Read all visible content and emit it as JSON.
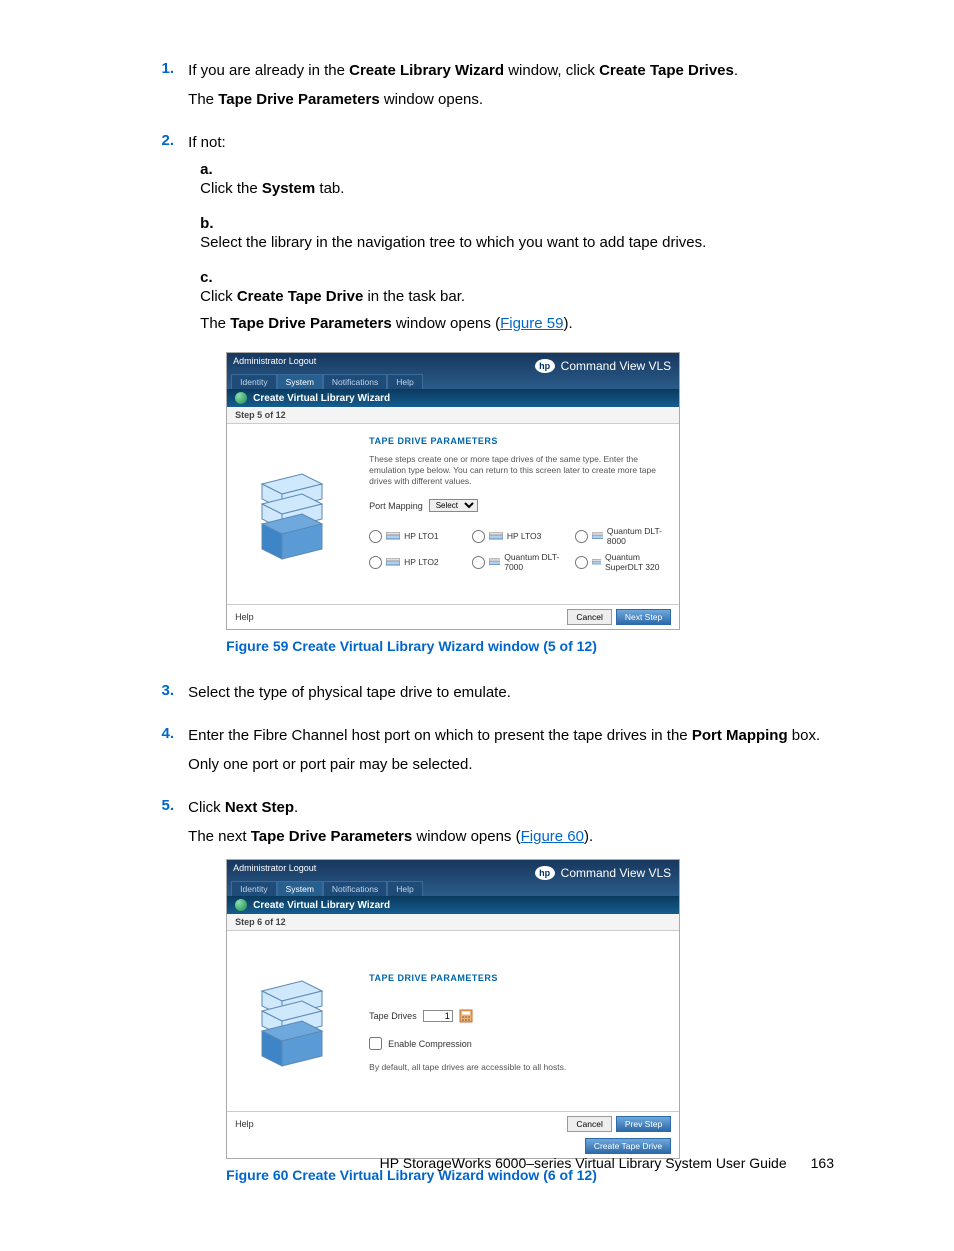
{
  "steps": {
    "s1_a": "If you are already in the ",
    "s1_b": "Create Library Wizard",
    "s1_c": " window, click ",
    "s1_d": "Create Tape Drives",
    "s1_e": ".",
    "s1_f": "The ",
    "s1_g": "Tape Drive Parameters",
    "s1_h": " window opens.",
    "s2": "If not:",
    "s2a_a": "Click the ",
    "s2a_b": "System",
    "s2a_c": " tab.",
    "s2b": "Select the library in the navigation tree to which you want to add tape drives.",
    "s2c_a": "Click ",
    "s2c_b": "Create Tape Drive",
    "s2c_c": " in the task bar.",
    "s2c_d": "The ",
    "s2c_e": "Tape Drive Parameters",
    "s2c_f": " window opens (",
    "s2c_g": "Figure 59",
    "s2c_h": ").",
    "s3": "Select the type of physical tape drive to emulate.",
    "s4_a": "Enter the Fibre Channel host port on which to present the tape drives in the ",
    "s4_b": "Port Mapping",
    "s4_c": " box.",
    "s4_d": "Only one port or port pair may be selected.",
    "s5_a": "Click ",
    "s5_b": "Next Step",
    "s5_c": ".",
    "s5_d": "The next ",
    "s5_e": "Tape Drive Parameters",
    "s5_f": " window opens (",
    "s5_g": "Figure 60",
    "s5_h": ")."
  },
  "markers": {
    "n1": "1.",
    "n2": "2.",
    "n3": "3.",
    "n4": "4.",
    "n5": "5.",
    "la": "a.",
    "lb": "b.",
    "lc": "c."
  },
  "fig59": {
    "caption": "Figure 59 Create Virtual Library Wizard window (5 of 12)",
    "top_left": "Administrator Logout",
    "brand": "Command View VLS",
    "hp": "hp",
    "tabs": {
      "identity": "Identity",
      "system": "System",
      "notifications": "Notifications",
      "help": "Help"
    },
    "bar": "Create Virtual Library Wizard",
    "step": "Step 5 of 12",
    "title": "TAPE DRIVE PARAMETERS",
    "desc": "These steps create one or more tape drives of the same type. Enter the emulation type below. You can return to this screen later to create more tape drives with different values.",
    "portmap": "Port Mapping",
    "select": "Select",
    "radios": {
      "r1": "HP LTO1",
      "r2": "HP LTO3",
      "r3": "Quantum DLT-8000",
      "r4": "HP LTO2",
      "r5": "Quantum DLT-7000",
      "r6": "Quantum SuperDLT 320"
    },
    "foot_help": "Help",
    "btn_cancel": "Cancel",
    "btn_next": "Next Step"
  },
  "fig60": {
    "caption": "Figure 60 Create Virtual Library Wizard window (6 of 12)",
    "top_left": "Administrator Logout",
    "brand": "Command View VLS",
    "hp": "hp",
    "tabs": {
      "identity": "Identity",
      "system": "System",
      "notifications": "Notifications",
      "help": "Help"
    },
    "bar": "Create Virtual Library Wizard",
    "step": "Step 6 of 12",
    "title": "TAPE DRIVE PARAMETERS",
    "tapedrives_label": "Tape Drives",
    "tapedrives_value": "1",
    "enable_compression": "Enable Compression",
    "desc2": "By default, all tape drives are accessible to all hosts.",
    "foot_help": "Help",
    "btn_cancel": "Cancel",
    "btn_prev": "Prev Step",
    "btn_create": "Create Tape Drive"
  },
  "footer": {
    "doc": "HP StorageWorks 6000–series Virtual Library System User Guide",
    "page": "163"
  }
}
